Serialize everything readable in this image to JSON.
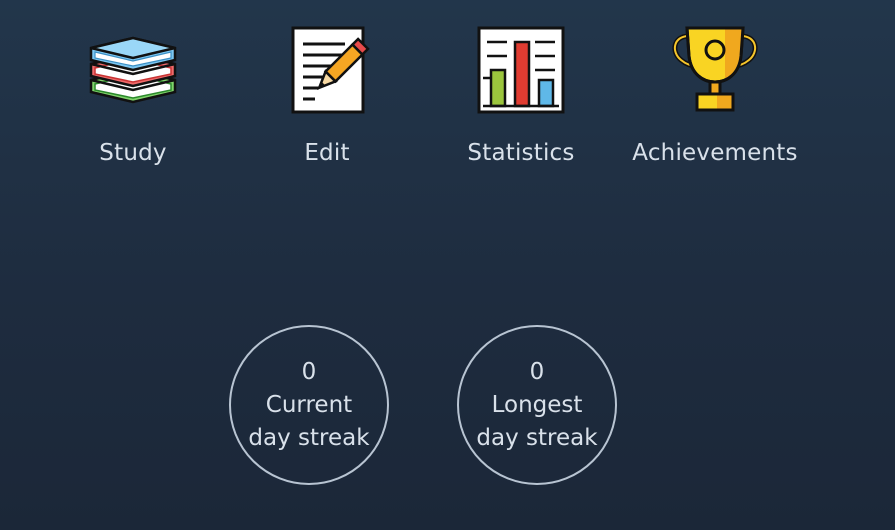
{
  "menu": {
    "items": [
      {
        "label": "Study",
        "icon": "books-icon"
      },
      {
        "label": "Edit",
        "icon": "edit-document-icon"
      },
      {
        "label": "Statistics",
        "icon": "bar-chart-icon"
      },
      {
        "label": "Achievements",
        "icon": "trophy-icon"
      }
    ]
  },
  "streaks": {
    "current": {
      "value": "0",
      "line1": "Current",
      "line2": "day streak"
    },
    "longest": {
      "value": "0",
      "line1": "Longest",
      "line2": "day streak"
    }
  },
  "colors": {
    "background_top": "#22364b",
    "background_bottom": "#1b2738",
    "text": "#d9e1ea",
    "circle_border": "#b8c4d2"
  }
}
